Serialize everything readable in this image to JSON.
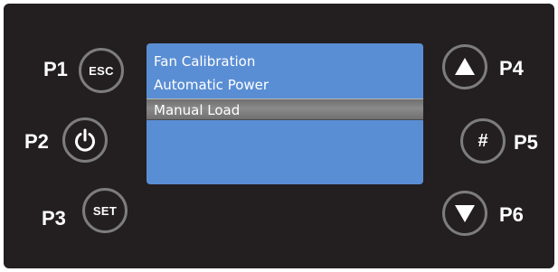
{
  "panel": {
    "left_buttons": [
      {
        "label": "P1",
        "button_text": "ESC",
        "icon": "esc-text"
      },
      {
        "label": "P2",
        "button_text": "",
        "icon": "power-icon"
      },
      {
        "label": "P3",
        "button_text": "SET",
        "icon": "set-text"
      }
    ],
    "right_buttons": [
      {
        "label": "P4",
        "button_text": "",
        "icon": "triangle-up-icon"
      },
      {
        "label": "P5",
        "button_text": "#",
        "icon": "hash-icon"
      },
      {
        "label": "P6",
        "button_text": "",
        "icon": "triangle-down-icon"
      }
    ]
  },
  "display": {
    "menu_items": [
      {
        "label": "Fan Calibration",
        "selected": false
      },
      {
        "label": "Automatic Power",
        "selected": false
      },
      {
        "label": "Manual Load",
        "selected": true
      }
    ],
    "background_color": "#5a8ed4",
    "selection_color": "#7a7a7a"
  },
  "colors": {
    "panel": "#231f20",
    "button_ring": "#7d7d7d",
    "text": "#ffffff"
  }
}
